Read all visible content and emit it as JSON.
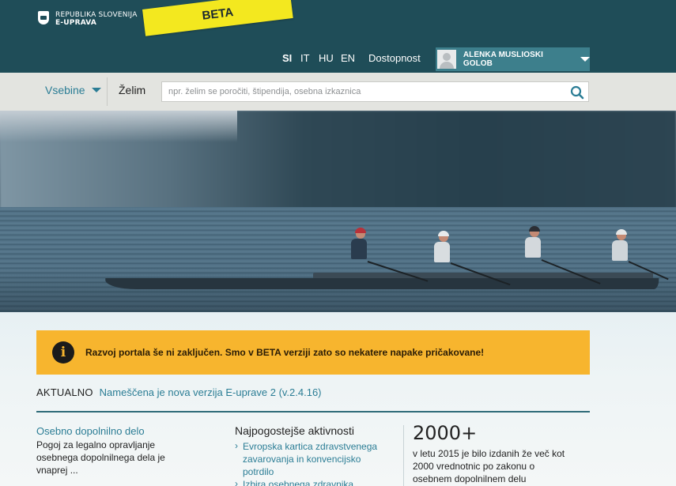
{
  "header": {
    "brand_line1": "REPUBLIKA SLOVENIJA",
    "brand_line2": "E-UPRAVA",
    "beta_label": "BETA",
    "languages": [
      "SI",
      "IT",
      "HU",
      "EN"
    ],
    "active_language": "SI",
    "accessibility_link": "Dostopnost",
    "user_name": "ALENKA MUSLIOSKI GOLOB"
  },
  "search": {
    "menu_label": "Vsebine",
    "want_label": "Želim",
    "placeholder": "npr. želim se poročiti, štipendija, osebna izkaznica"
  },
  "notice": {
    "icon": "i",
    "text": "Razvoj portala še ni zaključen. Smo v BETA verziji zato so nekatere napake pričakovane!"
  },
  "news": {
    "label": "AKTUALNO",
    "link": "Nameščena je nova verzija E-uprave 2 (v.2.4.16)"
  },
  "columns": {
    "col1": {
      "title": "Osebno dopolnilno delo",
      "text_lines": [
        "Pogoj za legalno opravljanje",
        "osebnega dopolnilnega dela je",
        "vnaprej ..."
      ]
    },
    "col2": {
      "title": "Najpogostejše aktivnosti",
      "item1_lines": [
        "Evropska kartica zdravstvenega",
        "zavarovanja in konvencijsko",
        "potrdilo"
      ],
      "item2_partial": "Izbira osebnega zdravnika"
    },
    "col3": {
      "big_number": "2000+",
      "text_lines": [
        "v letu 2015 je bilo izdanih že več kot",
        "2000 vrednotnic po zakonu o",
        "osebnem dopolnilnem delu"
      ]
    }
  },
  "colors": {
    "header": "#1f4d58",
    "accent": "#2b7d95",
    "beta": "#f3e81f",
    "notice": "#f7b52e"
  }
}
